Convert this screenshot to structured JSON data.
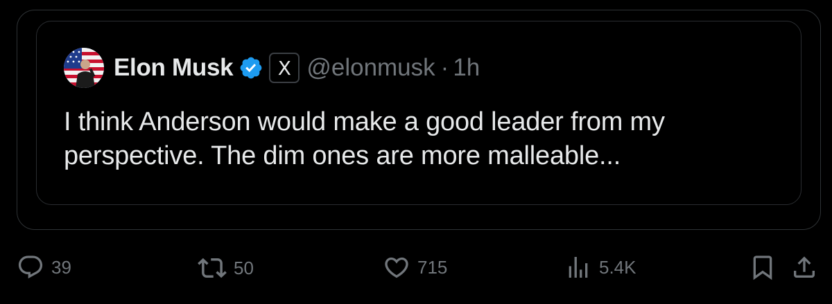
{
  "tweet": {
    "author_name": "Elon Musk",
    "handle": "@elonmusk",
    "separator": "·",
    "time": "1h",
    "affiliate_badge": "X",
    "text": "I think Anderson would make a good leader from my perspective. The dim ones are more malleable..."
  },
  "actions": {
    "replies": "39",
    "reposts": "50",
    "likes": "715",
    "views": "5.4K"
  },
  "icons": [
    "avatar",
    "verified-badge-icon",
    "x-logo-icon",
    "reply-icon",
    "repost-icon",
    "like-icon",
    "views-icon",
    "bookmark-icon",
    "share-icon"
  ],
  "colors": {
    "background": "#000000",
    "text": "#e7e9ea",
    "muted": "#71767b",
    "verified": "#1d9bf0",
    "border": "#2f3336"
  }
}
